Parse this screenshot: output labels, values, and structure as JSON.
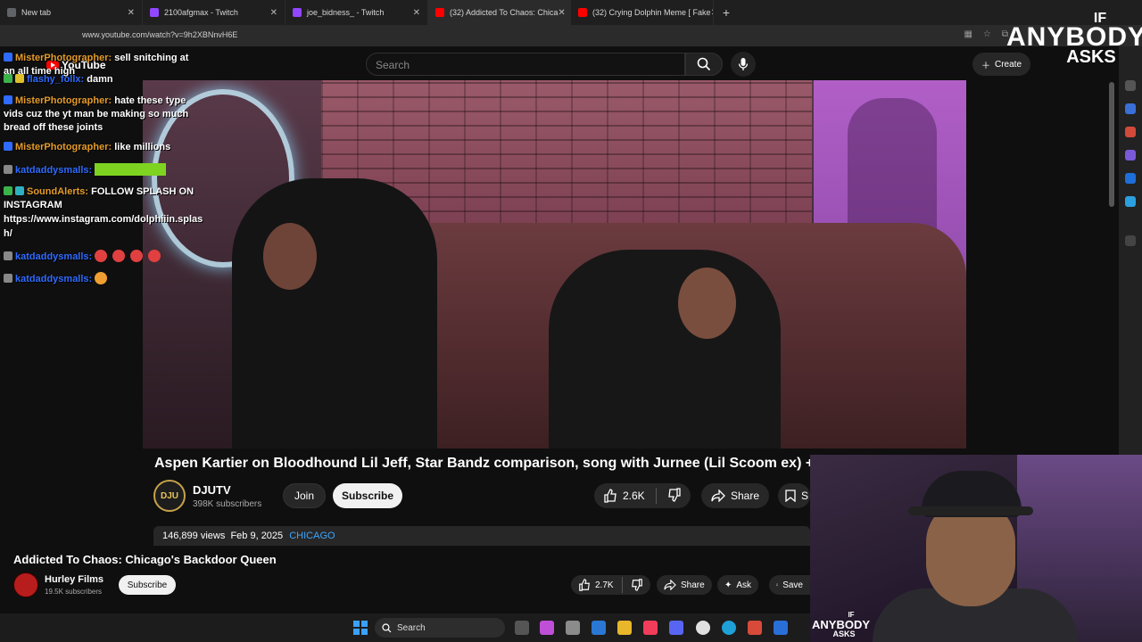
{
  "browser": {
    "tabs": [
      {
        "label": "New tab",
        "color": "#5f6368"
      },
      {
        "label": "2100afgmax - Twitch",
        "color": "#9146ff"
      },
      {
        "label": "joe_bidness_ - Twitch",
        "color": "#9146ff"
      },
      {
        "label": "(32) Addicted To Chaos: Chica",
        "color": "#ff0000"
      },
      {
        "label": "(32) Crying Dolphin Meme [ Fake",
        "color": "#ff0000"
      }
    ],
    "url": "www.youtube.com/watch?v=9h2XBNnvH6E"
  },
  "youtube": {
    "logo_text": "YouTube",
    "search_placeholder": "Search",
    "create_label": "Create"
  },
  "chat": [
    {
      "user": "MisterPhotographer:",
      "msg": "sell snitching at"
    },
    {
      "user": "",
      "msg": "an all time high"
    },
    {
      "user": "flashy_follx:",
      "msg": "damn"
    },
    {
      "user": "MisterPhotographer:",
      "msg": "hate these type"
    },
    {
      "user": "",
      "msg": "vids cuz the yt man be making so much"
    },
    {
      "user": "",
      "msg": "bread off these joints"
    },
    {
      "user": "MisterPhotographer:",
      "msg": "like millions"
    },
    {
      "user": "katdaddysmalls:",
      "msg": ""
    },
    {
      "user": "SoundAlerts:",
      "msg": "FOLLOW SPLASH ON"
    },
    {
      "user": "",
      "msg": "INSTAGRAM"
    },
    {
      "user": "",
      "msg": "https://www.instagram.com/dolphiiin.splas"
    },
    {
      "user": "",
      "msg": "h/"
    },
    {
      "user": "katdaddysmalls:",
      "msg": ""
    },
    {
      "user": "katdaddysmalls:",
      "msg": ""
    }
  ],
  "video": {
    "title": "Aspen Kartier on Bloodhound Lil Jeff, Star Bandz comparison, song with Jurnee (Lil Scoom ex) + m",
    "channel": "DJUTV",
    "avatar_text": "DJU",
    "subscribers": "398K subscribers",
    "join_label": "Join",
    "subscribe_label": "Subscribe",
    "likes": "2.6K",
    "share_label": "Share",
    "save_label": "S",
    "views": "146,899 views",
    "date": "Feb 9, 2025",
    "tag": "CHICAGO"
  },
  "bottom": {
    "title": "Addicted To Chaos: Chicago's Backdoor Queen",
    "channel": "Hurley Films",
    "subscribers": "19.5K subscribers",
    "subscribe_label": "Subscribe",
    "likes": "2.7K",
    "share_label": "Share",
    "ask_label": "Ask",
    "save_label": "Save"
  },
  "brand": {
    "line1": "IF",
    "line2": "ANYBODY",
    "line3": "ASKS"
  },
  "taskbar": {
    "search_label": "Search"
  }
}
